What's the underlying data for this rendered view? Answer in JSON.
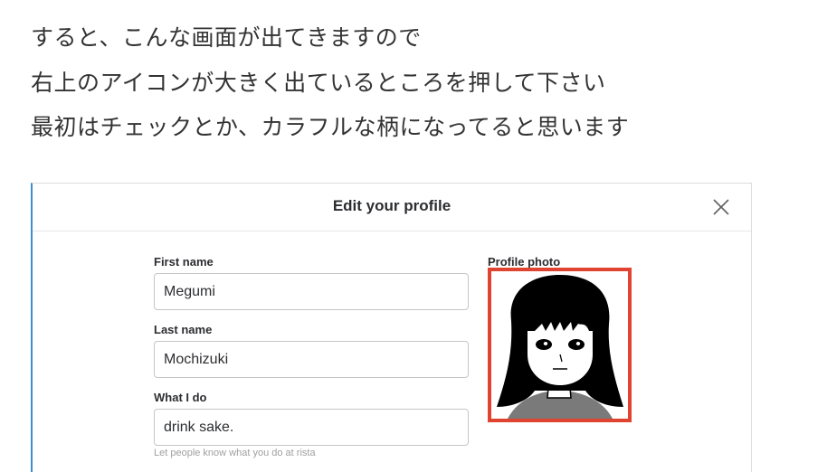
{
  "article": {
    "line1": "すると、こんな画面が出てきますので",
    "line2": "右上のアイコンが大きく出ているところを押して下さい",
    "line3": "最初はチェックとか、カラフルな柄になってると思います"
  },
  "modal": {
    "title": "Edit your profile",
    "close_icon": "close-x-icon",
    "fields": {
      "first_name": {
        "label": "First name",
        "value": "Megumi"
      },
      "last_name": {
        "label": "Last name",
        "value": "Mochizuki"
      },
      "what_i_do": {
        "label": "What I do",
        "value": "drink sake.",
        "hint": "Let people know what you do at rista"
      }
    },
    "photo": {
      "label": "Profile photo",
      "highlight_color": "#e0432f"
    }
  },
  "colors": {
    "accent_border": "#3b8fd0",
    "text": "#333333"
  }
}
